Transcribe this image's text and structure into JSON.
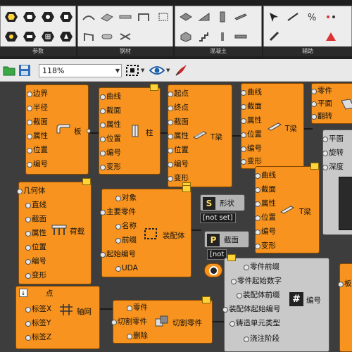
{
  "ribbon": {
    "panels": [
      {
        "label": "参数"
      },
      {
        "label": "钢材"
      },
      {
        "label": "混凝土"
      },
      {
        "label": "辅助"
      }
    ]
  },
  "toolbar": {
    "zoom": "118%"
  },
  "canvas": {
    "comp_plate": {
      "inputs": [
        "边界",
        "半径",
        "截面",
        "属性",
        "位置",
        "编号"
      ],
      "name": "板"
    },
    "comp_column": {
      "inputs": [
        "曲线",
        "截面",
        "属性",
        "位置",
        "编号",
        "变形"
      ],
      "name": "柱"
    },
    "comp_tbeam1": {
      "inputs": [
        "起点",
        "终点",
        "截面",
        "属性",
        "位置",
        "编号",
        "变形"
      ],
      "name": "T梁"
    },
    "comp_tbeam2": {
      "inputs": [
        "曲线",
        "截面",
        "属性",
        "位置",
        "编号",
        "变形"
      ],
      "name": "T梁"
    },
    "comp_part": {
      "inputs": [
        "零件",
        "平面",
        "翻转"
      ]
    },
    "comp_plane": {
      "inputs": [
        "平面",
        "旋转",
        "深度"
      ]
    },
    "comp_load": {
      "inputs": [
        "几何体",
        "直线",
        "截面",
        "属性",
        "位置",
        "编号",
        "变形"
      ],
      "name": "荷载"
    },
    "comp_assembly": {
      "inputs": [
        "对象",
        "主要零件",
        "名称",
        "前缀",
        "起始编号",
        "UDA"
      ],
      "name": "装配体"
    },
    "param_shape": {
      "letter": "S",
      "label": "形状",
      "value": "[not set]"
    },
    "param_profile": {
      "letter": "P",
      "label": "截面",
      "value": "[not"
    },
    "comp_tbeam3": {
      "inputs": [
        "曲线",
        "截面",
        "属性",
        "位置",
        "编号",
        "变形"
      ],
      "name": "T梁"
    },
    "comp_numbering": {
      "inputs": [
        "零件前缀",
        "零件起始数字",
        "装配体前缀",
        "装配体起始编号",
        "铸造单元类型",
        "浇注阶段"
      ],
      "name": "编号"
    },
    "comp_grid": {
      "inputs": [
        "点",
        "标签X",
        "标签Y",
        "标签Z"
      ],
      "name": "轴网"
    },
    "comp_cutpart": {
      "inputs": [
        "零件",
        "切割零件",
        "删除"
      ],
      "name": "切割零件"
    },
    "comp_edge": {
      "label": "板"
    }
  }
}
